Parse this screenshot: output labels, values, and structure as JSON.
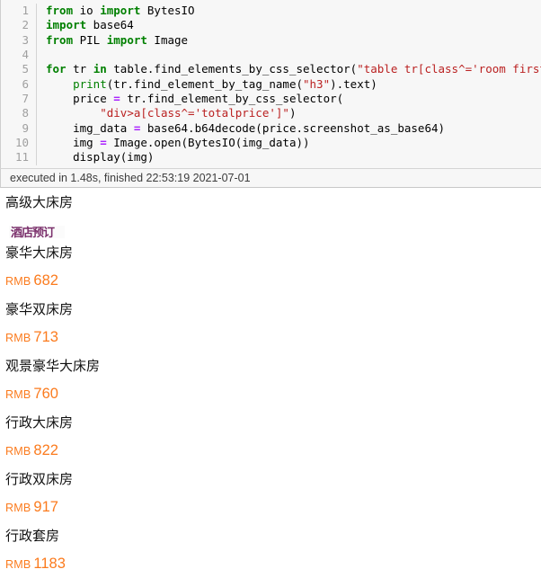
{
  "cell": {
    "line_numbers": [
      "1",
      "2",
      "3",
      "4",
      "5",
      "6",
      "7",
      "8",
      "9",
      "10",
      "11"
    ],
    "lines": [
      {
        "tokens": [
          {
            "t": "from",
            "c": "kw"
          },
          {
            "t": " io ",
            "c": "pl"
          },
          {
            "t": "import",
            "c": "kw"
          },
          {
            "t": " BytesIO",
            "c": "pl"
          }
        ]
      },
      {
        "tokens": [
          {
            "t": "import",
            "c": "kw"
          },
          {
            "t": " base64",
            "c": "pl"
          }
        ]
      },
      {
        "tokens": [
          {
            "t": "from",
            "c": "kw"
          },
          {
            "t": " PIL ",
            "c": "pl"
          },
          {
            "t": "import",
            "c": "kw"
          },
          {
            "t": " Image",
            "c": "pl"
          }
        ]
      },
      {
        "tokens": []
      },
      {
        "tokens": [
          {
            "t": "for",
            "c": "kw"
          },
          {
            "t": " tr ",
            "c": "pl"
          },
          {
            "t": "in",
            "c": "kw"
          },
          {
            "t": " table.find_elements_by_css_selector(",
            "c": "pl"
          },
          {
            "t": "\"table tr[class^='room first']\"",
            "c": "str"
          },
          {
            "t": "):",
            "c": "pl"
          }
        ]
      },
      {
        "tokens": [
          {
            "t": "    ",
            "c": "pl"
          },
          {
            "t": "print",
            "c": "bi"
          },
          {
            "t": "(tr.find_element_by_tag_name(",
            "c": "pl"
          },
          {
            "t": "\"h3\"",
            "c": "str"
          },
          {
            "t": ").text)",
            "c": "pl"
          }
        ]
      },
      {
        "tokens": [
          {
            "t": "    price ",
            "c": "pl"
          },
          {
            "t": "=",
            "c": "op"
          },
          {
            "t": " tr.find_element_by_css_selector(",
            "c": "pl"
          }
        ]
      },
      {
        "tokens": [
          {
            "t": "        ",
            "c": "pl"
          },
          {
            "t": "\"div>a[class^='totalprice']\"",
            "c": "str"
          },
          {
            "t": ")",
            "c": "pl"
          }
        ]
      },
      {
        "tokens": [
          {
            "t": "    img_data ",
            "c": "pl"
          },
          {
            "t": "=",
            "c": "op"
          },
          {
            "t": " base64.b64decode(price.screenshot_as_base64)",
            "c": "pl"
          }
        ]
      },
      {
        "tokens": [
          {
            "t": "    img ",
            "c": "pl"
          },
          {
            "t": "=",
            "c": "op"
          },
          {
            "t": " Image.open(BytesIO(img_data))",
            "c": "pl"
          }
        ]
      },
      {
        "tokens": [
          {
            "t": "    display(img)",
            "c": "pl"
          }
        ]
      }
    ]
  },
  "status": {
    "text": "executed in 1.48s, finished 22:53:19 2021-07-01"
  },
  "output": {
    "currency_label": "RMB",
    "accent_color": "#fb7b1e",
    "entries": [
      {
        "name": "高级大床房",
        "price": null,
        "has_image": true
      },
      {
        "name": "豪华大床房",
        "price": "682",
        "has_image": false
      },
      {
        "name": "豪华双床房",
        "price": "713",
        "has_image": false
      },
      {
        "name": "观景豪华大床房",
        "price": "760",
        "has_image": false
      },
      {
        "name": "行政大床房",
        "price": "822",
        "has_image": false
      },
      {
        "name": "行政双床房",
        "price": "917",
        "has_image": false
      },
      {
        "name": "行政套房",
        "price": "1183",
        "has_image": false
      }
    ],
    "clipped_image_text": "酒店预订"
  }
}
